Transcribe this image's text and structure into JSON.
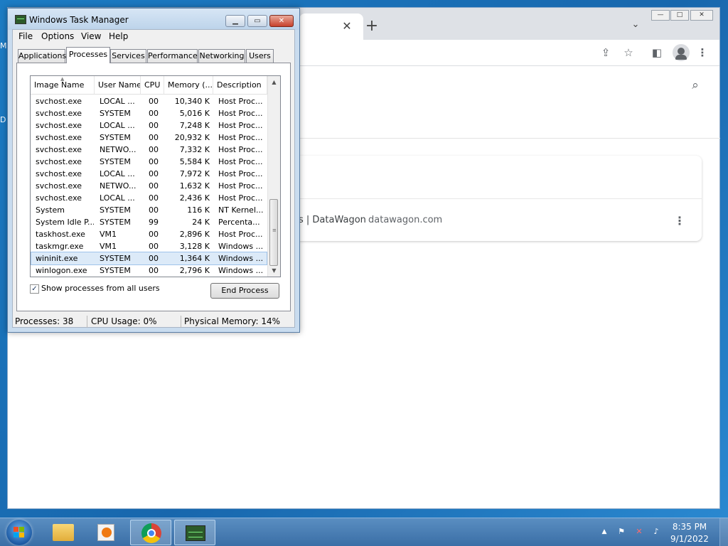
{
  "desktop": {
    "fragment_top": "M",
    "fragment_mid": "D"
  },
  "browser": {
    "tab_close_glyph": "✕",
    "new_tab_glyph": "+",
    "tab_search_glyph": "⌄",
    "window_controls": {
      "minimize": "—",
      "maximize": "□",
      "close": "✕"
    },
    "toolbar_icons": [
      "share-icon",
      "star-icon",
      "sidepanel-icon",
      "profile-icon",
      "menu-icon"
    ],
    "result": {
      "title": "s | DataWagon",
      "url": "datawagon.com"
    }
  },
  "taskmgr": {
    "title": "Windows Task Manager",
    "menu": [
      "File",
      "Options",
      "View",
      "Help"
    ],
    "tabs": [
      "Applications",
      "Processes",
      "Services",
      "Performance",
      "Networking",
      "Users"
    ],
    "active_tab": "Processes",
    "columns": [
      "Image Name",
      "User Name",
      "CPU",
      "Memory (...",
      "Description"
    ],
    "rows": [
      [
        "svchost.exe",
        "LOCAL ...",
        "00",
        "10,340 K",
        "Host Proc..."
      ],
      [
        "svchost.exe",
        "SYSTEM",
        "00",
        "5,016 K",
        "Host Proc..."
      ],
      [
        "svchost.exe",
        "LOCAL ...",
        "00",
        "7,248 K",
        "Host Proc..."
      ],
      [
        "svchost.exe",
        "SYSTEM",
        "00",
        "20,932 K",
        "Host Proc..."
      ],
      [
        "svchost.exe",
        "NETWO...",
        "00",
        "7,332 K",
        "Host Proc..."
      ],
      [
        "svchost.exe",
        "SYSTEM",
        "00",
        "5,584 K",
        "Host Proc..."
      ],
      [
        "svchost.exe",
        "LOCAL ...",
        "00",
        "7,972 K",
        "Host Proc..."
      ],
      [
        "svchost.exe",
        "NETWO...",
        "00",
        "1,632 K",
        "Host Proc..."
      ],
      [
        "svchost.exe",
        "LOCAL ...",
        "00",
        "2,436 K",
        "Host Proc..."
      ],
      [
        "System",
        "SYSTEM",
        "00",
        "116 K",
        "NT Kernel..."
      ],
      [
        "System Idle P...",
        "SYSTEM",
        "99",
        "24 K",
        "Percenta..."
      ],
      [
        "taskhost.exe",
        "VM1",
        "00",
        "2,896 K",
        "Host Proc..."
      ],
      [
        "taskmgr.exe",
        "VM1",
        "00",
        "3,128 K",
        "Windows ..."
      ],
      [
        "wininit.exe",
        "SYSTEM",
        "00",
        "1,364 K",
        "Windows ..."
      ],
      [
        "winlogon.exe",
        "SYSTEM",
        "00",
        "2,796 K",
        "Windows ..."
      ]
    ],
    "selected_row": "wininit.exe",
    "show_all_users": {
      "label": "Show processes from all users",
      "checked": true
    },
    "end_process_label": "End Process",
    "status": {
      "processes": "Processes: 38",
      "cpu": "CPU Usage: 0%",
      "memory": "Physical Memory: 14%"
    }
  },
  "taskbar": {
    "pinned": [
      "windows-explorer",
      "windows-media-player",
      "google-chrome",
      "task-manager"
    ],
    "tray_arrow": "▲",
    "time": "8:35 PM",
    "date": "9/1/2022"
  }
}
